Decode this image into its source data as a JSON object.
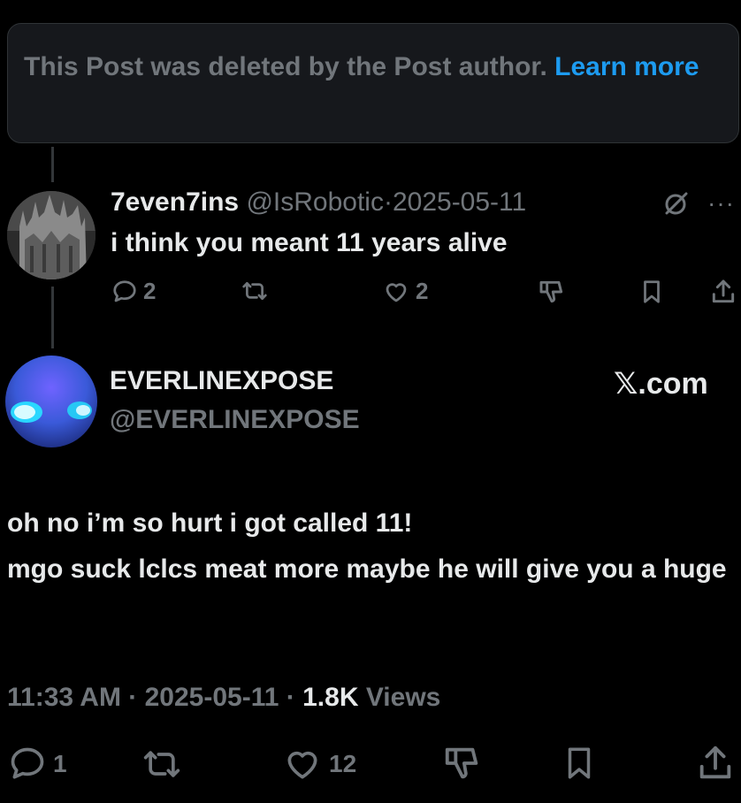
{
  "deleted_notice": {
    "text": "This Post was deleted by the Post author.",
    "link": "Learn more"
  },
  "reply": {
    "display_name": "7even7ins",
    "handle": "@IsRobotic",
    "separator": "·",
    "date": "2025-05-11",
    "text": "i think you meant 11 years alive",
    "replies": "2",
    "likes": "2"
  },
  "post": {
    "display_name": "EVERLINEXPOSE",
    "handle": "@EVERLINEXPOSE",
    "brand": "𝕏.com",
    "text": "oh no i’m so hurt i got called 11!\nmgo suck lclcs meat more maybe he will give you a huge",
    "time": "11:33 AM",
    "date": "2025-05-11",
    "views_count": "1.8K",
    "views_label": "Views",
    "replies": "1",
    "likes": "12"
  },
  "icons": [
    "reply-icon",
    "repost-icon",
    "like-icon",
    "dislike-icon",
    "bookmark-icon",
    "share-icon",
    "grok-icon",
    "more-icon"
  ],
  "colors": {
    "background": "#000000",
    "muted": "#71767b",
    "link": "#1d9bf0",
    "text": "#e7e9ea"
  }
}
